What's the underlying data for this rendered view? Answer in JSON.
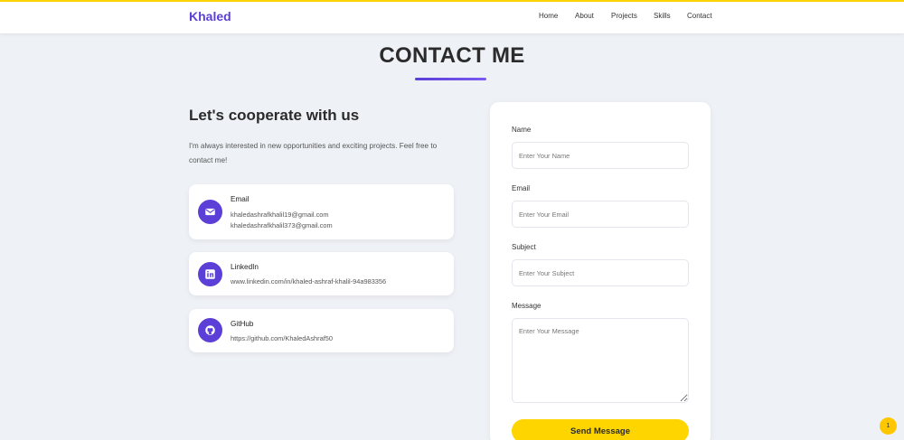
{
  "nav": {
    "brand": "Khaled",
    "links": [
      "Home",
      "About",
      "Projects",
      "Skills",
      "Contact"
    ]
  },
  "section": {
    "title": "CONTACT ME"
  },
  "intro": {
    "heading": "Let's cooperate with us",
    "text": "I'm always interested in new opportunities and exciting projects. Feel free to contact me!"
  },
  "contacts": {
    "email": {
      "title": "Email",
      "lines": [
        "khaledashrafkhalil19@gmail.com",
        "khaledashrafkhalil373@gmail.com"
      ],
      "icon": "envelope-icon"
    },
    "linkedin": {
      "title": "LinkedIn",
      "lines": [
        "www.linkedin.com/in/khaled-ashraf-khalil-94a983356"
      ],
      "icon": "linkedin-icon"
    },
    "github": {
      "title": "GitHub",
      "lines": [
        "https://github.com/KhaledAshraf50"
      ],
      "icon": "github-icon"
    }
  },
  "form": {
    "name": {
      "label": "Name",
      "placeholder": "Enter Your Name"
    },
    "email": {
      "label": "Email",
      "placeholder": "Enter Your Email"
    },
    "subject": {
      "label": "Subject",
      "placeholder": "Enter Your Subject"
    },
    "message": {
      "label": "Message",
      "placeholder": "Enter Your Message"
    },
    "submit_label": "Send Message"
  },
  "badge": {
    "text": "1"
  },
  "colors": {
    "accent": "#5b3fd6",
    "button": "#ffd500",
    "background": "#eef1f6"
  }
}
